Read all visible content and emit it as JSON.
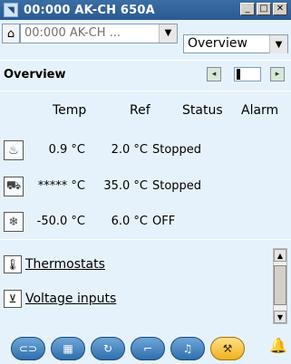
{
  "window": {
    "title": "00:000 AK-CH 650A",
    "controls": [
      "_",
      "□",
      "✕"
    ]
  },
  "toolbar": {
    "device_value": "00:000 AK-CH ...",
    "view_value": "Overview"
  },
  "overview": {
    "title": "Overview"
  },
  "table": {
    "headers": {
      "temp": "Temp",
      "ref": "Ref",
      "status": "Status",
      "alarm": "Alarm"
    },
    "rows": [
      {
        "icon": "cabinet-icon",
        "temp": "0.9 °C",
        "ref": "2.0 °C",
        "status": "Stopped"
      },
      {
        "icon": "freezer-icon",
        "temp": "***** °C",
        "ref": "35.0 °C",
        "status": "Stopped"
      },
      {
        "icon": "defrost-icon",
        "temp": "-50.0 °C",
        "ref": "6.0 °C",
        "status": "OFF"
      }
    ]
  },
  "links": [
    {
      "icon": "thermostat-icon",
      "label": "Thermostats"
    },
    {
      "icon": "voltage-icon",
      "label": "Voltage inputs"
    }
  ],
  "nav": {
    "buttons": [
      {
        "icon": "cases-icon",
        "active": false
      },
      {
        "icon": "grid-icon",
        "active": false
      },
      {
        "icon": "cycle-icon",
        "active": false
      },
      {
        "icon": "graph-icon",
        "active": false
      },
      {
        "icon": "bell-icon",
        "active": false
      },
      {
        "icon": "wrench-icon",
        "active": true
      }
    ],
    "alarm_color": "#e01010"
  }
}
